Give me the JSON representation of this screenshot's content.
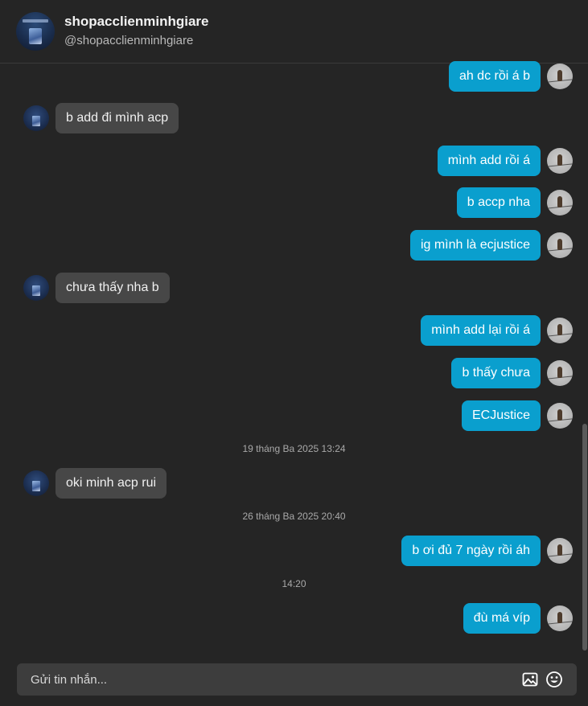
{
  "header": {
    "name": "shopacclienminhgiare",
    "handle": "@shopacclienminhgiare"
  },
  "messages": [
    {
      "from": "me",
      "text": "ah dc rồi á b"
    },
    {
      "from": "them",
      "text": "b add đi mình acp"
    },
    {
      "from": "me",
      "text": "mình add rồi á"
    },
    {
      "from": "me",
      "text": "b accp nha"
    },
    {
      "from": "me",
      "text": "ig mình là ecjustice"
    },
    {
      "from": "them",
      "text": "chưa thấy nha b"
    },
    {
      "from": "me",
      "text": "mình add lại rồi á"
    },
    {
      "from": "me",
      "text": "b thấy chưa"
    },
    {
      "from": "me",
      "text": "ECJustice"
    },
    {
      "timestamp": "19 tháng Ba 2025 13:24"
    },
    {
      "from": "them",
      "text": "oki minh acp rui"
    },
    {
      "timestamp": "26 tháng Ba 2025 20:40"
    },
    {
      "from": "me",
      "text": "b ơi đủ 7 ngày rồi áh"
    },
    {
      "timestamp": "14:20"
    },
    {
      "from": "me",
      "text": "đù má víp"
    }
  ],
  "composer": {
    "placeholder": "Gửi tin nhắn...",
    "value": ""
  },
  "icons": {
    "image": "image-icon",
    "emoji": "emoji-icon"
  },
  "colors": {
    "outgoing_bubble": "#0a9fce",
    "incoming_bubble": "#474747",
    "background": "#252525"
  }
}
